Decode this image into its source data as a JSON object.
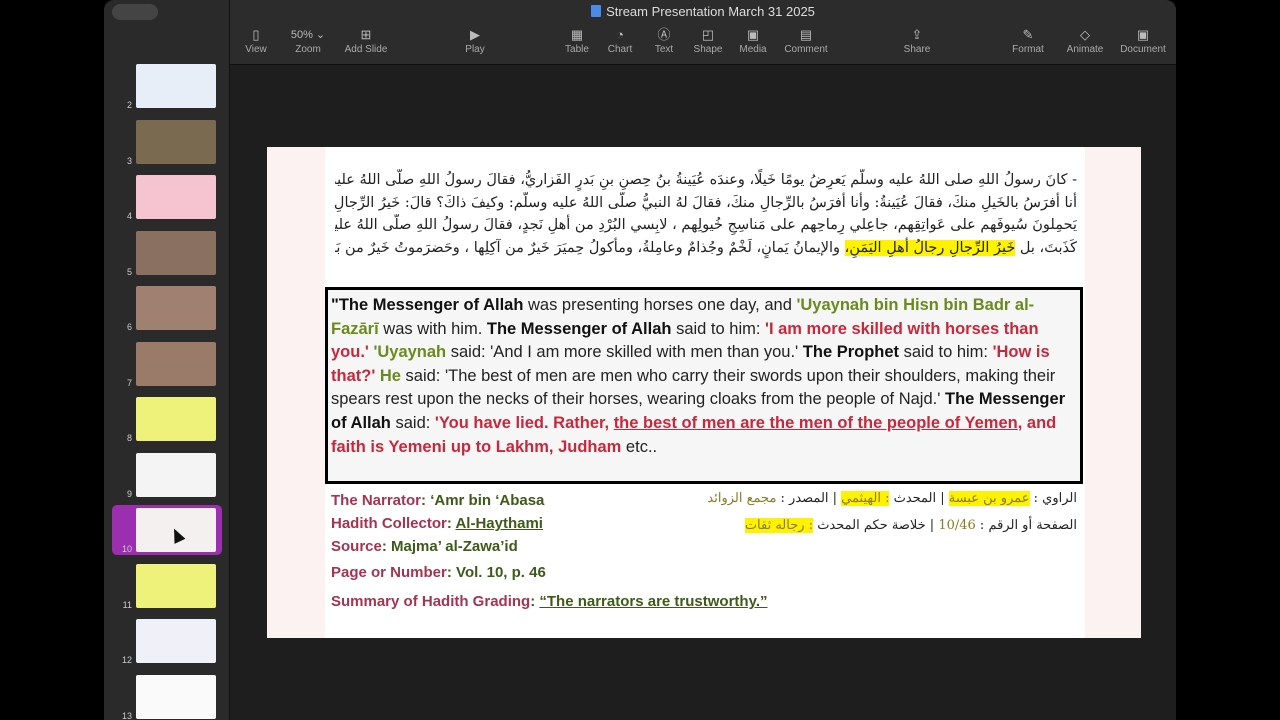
{
  "window": {
    "title": "Stream Presentation March 31 2025"
  },
  "toolbar": [
    {
      "label": "View",
      "icon": "sidebar-icon",
      "glyph": "▯"
    },
    {
      "label": "Zoom",
      "value": "50% ⌄",
      "icon": "zoom"
    },
    {
      "label": "Add Slide",
      "icon": "plus-square-icon",
      "glyph": "⊞"
    },
    {
      "label": "Play",
      "icon": "play-icon",
      "glyph": "▶"
    },
    {
      "label": "Table",
      "icon": "table-icon",
      "glyph": "▦"
    },
    {
      "label": "Chart",
      "icon": "chart-icon",
      "glyph": "◔"
    },
    {
      "label": "Text",
      "icon": "text-icon",
      "glyph": "Ⓐ"
    },
    {
      "label": "Shape",
      "icon": "shape-icon",
      "glyph": "◰"
    },
    {
      "label": "Media",
      "icon": "media-icon",
      "glyph": "▣"
    },
    {
      "label": "Comment",
      "icon": "comment-icon",
      "glyph": "▤"
    },
    {
      "label": "Share",
      "icon": "share-icon",
      "glyph": "⇪"
    },
    {
      "label": "Format",
      "icon": "brush-icon",
      "glyph": "✎"
    },
    {
      "label": "Animate",
      "icon": "diamond-icon",
      "glyph": "◇"
    },
    {
      "label": "Document",
      "icon": "document-icon",
      "glyph": "▣"
    }
  ],
  "sidebar": {
    "slides": [
      {
        "num": "2",
        "color": "#e8eef8"
      },
      {
        "num": "3",
        "color": "#7a6a50"
      },
      {
        "num": "4",
        "color": "#f6c4d0"
      },
      {
        "num": "5",
        "color": "#8a7060"
      },
      {
        "num": "6",
        "color": "#a08070"
      },
      {
        "num": "7",
        "color": "#9a7a68"
      },
      {
        "num": "8",
        "color": "#eef27a"
      },
      {
        "num": "9",
        "color": "#f4f4f4"
      },
      {
        "num": "10",
        "color": "#f4f0f0",
        "selected": true
      },
      {
        "num": "11",
        "color": "#eef27a"
      },
      {
        "num": "12",
        "color": "#f0f0f8"
      },
      {
        "num": "13",
        "color": "#fafafa"
      }
    ]
  },
  "slide": {
    "arabic_lines": [
      [
        {
          "t": "- كانَ رسولُ اللهِ صلى اللهُ عليه وسلَّم يَعرِضُ يومًا خَيلًا، وعندَه عُيَينةُ بنُ حِصنِ بنِ بَدرٍ الفَزاريُّ، فقالَ رسولُ اللهِ صلَّى اللهُ عليه وسلَّم:"
        }
      ],
      [
        {
          "t": "أنا أفرَسُ بالخَيلِ منكَ، فقالَ عُيَينةُ: وأنا أفرَسُ بالرِّجالِ منكَ، فقالَ لهُ النبيُّ صلَّى اللهُ عليه وسلَّم: وكيفَ ذاكَ؟ قالَ: خَيرُ الرِّجالِ رِجالٌ"
        }
      ],
      [
        {
          "t": "يَحمِلونَ سُيوفَهم على عَواتِقِهم، جاعِلي رِماحِهم على مَناسِجِ خُيولِهم ، لابِسي البُرْدِ من أهلِ نَجدٍ، فقالَ رسولُ اللهِ صلَّى اللهُ عليه وسلَّم:"
        }
      ],
      [
        {
          "t": "كَذَبتَ، بل "
        },
        {
          "t": "خَيرُ الرِّجالِ رجالُ أهلِ اليَمَنِ،",
          "hl": true
        },
        {
          "t": " والإيمانُ يَمانٍ، لَخْمٌ وجُذامٌ وعامِلةُ، ومأكولُ حِميَرَ خَيرٌ من آكِلِها ، وحَضرَموتُ خَيرٌ من بَني"
        }
      ]
    ],
    "english": [
      {
        "t": "\"",
        "s": "b"
      },
      {
        "t": "The Messenger of Allah",
        "s": "b"
      },
      {
        "t": " was presenting horses one day, and "
      },
      {
        "t": "'Uyaynah bin Hisn bin Badr al-Fazārī",
        "s": "g"
      },
      {
        "t": " was with him. "
      },
      {
        "t": "The Messenger of Allah",
        "s": "b"
      },
      {
        "t": " said to him: "
      },
      {
        "t": "'I am more skilled with horses than you.'",
        "s": "r"
      },
      {
        "t": " "
      },
      {
        "t": "'Uyaynah",
        "s": "g"
      },
      {
        "t": " said: 'And I am more skilled with men than you.' "
      },
      {
        "t": "The Prophet",
        "s": "b"
      },
      {
        "t": " said to him: "
      },
      {
        "t": "'How is that?'",
        "s": "r"
      },
      {
        "t": " "
      },
      {
        "t": "He",
        "s": "g"
      },
      {
        "t": " said: 'The best of men are men who carry their swords upon their shoulders, making their spears rest upon the necks of their horses, wearing cloaks from the people of Najd.' "
      },
      {
        "t": "The Messenger of Allah",
        "s": "b"
      },
      {
        "t": " said: "
      },
      {
        "t": "'You have lied. Rather, ",
        "s": "r"
      },
      {
        "t": "the best of men are the men of the people of Yemen",
        "s": "ru"
      },
      {
        "t": ", and faith is Yemeni up to Lakhm, Judham",
        "s": "r"
      },
      {
        "t": " etc.."
      }
    ],
    "meta": [
      {
        "label": "The Narrator",
        "value": "‘Amr bin ‘Abasa"
      },
      {
        "label": "Hadith Collector",
        "value": "Al-Haythami",
        "underline": true
      },
      {
        "label": "Source",
        "value": "Majma’ al-Zawa’id"
      },
      {
        "label": "Page or Number",
        "value": "Vol. 10, p. 46"
      },
      {
        "label": "Summary of Hadith Grading",
        "value": "“The narrators are trustworthy.”",
        "underline": true
      }
    ],
    "arabic_meta": [
      [
        {
          "t": "الراوي : "
        },
        {
          "t": "عمرو بن عبسة",
          "hl": true,
          "o": true
        },
        {
          "t": " | المحدث "
        },
        {
          "t": ": الهيثمي",
          "hl": true,
          "o": true
        },
        {
          "t": " | المصدر : "
        },
        {
          "t": "مجمع الزوائد",
          "o": true
        }
      ],
      [
        {
          "t": "الصفحة أو الرقم : "
        },
        {
          "t": "10/46",
          "o": true
        },
        {
          "t": " | خلاصة حكم المحدث "
        },
        {
          "t": ": رجاله ثقات",
          "hl": true,
          "o": true
        }
      ]
    ]
  }
}
